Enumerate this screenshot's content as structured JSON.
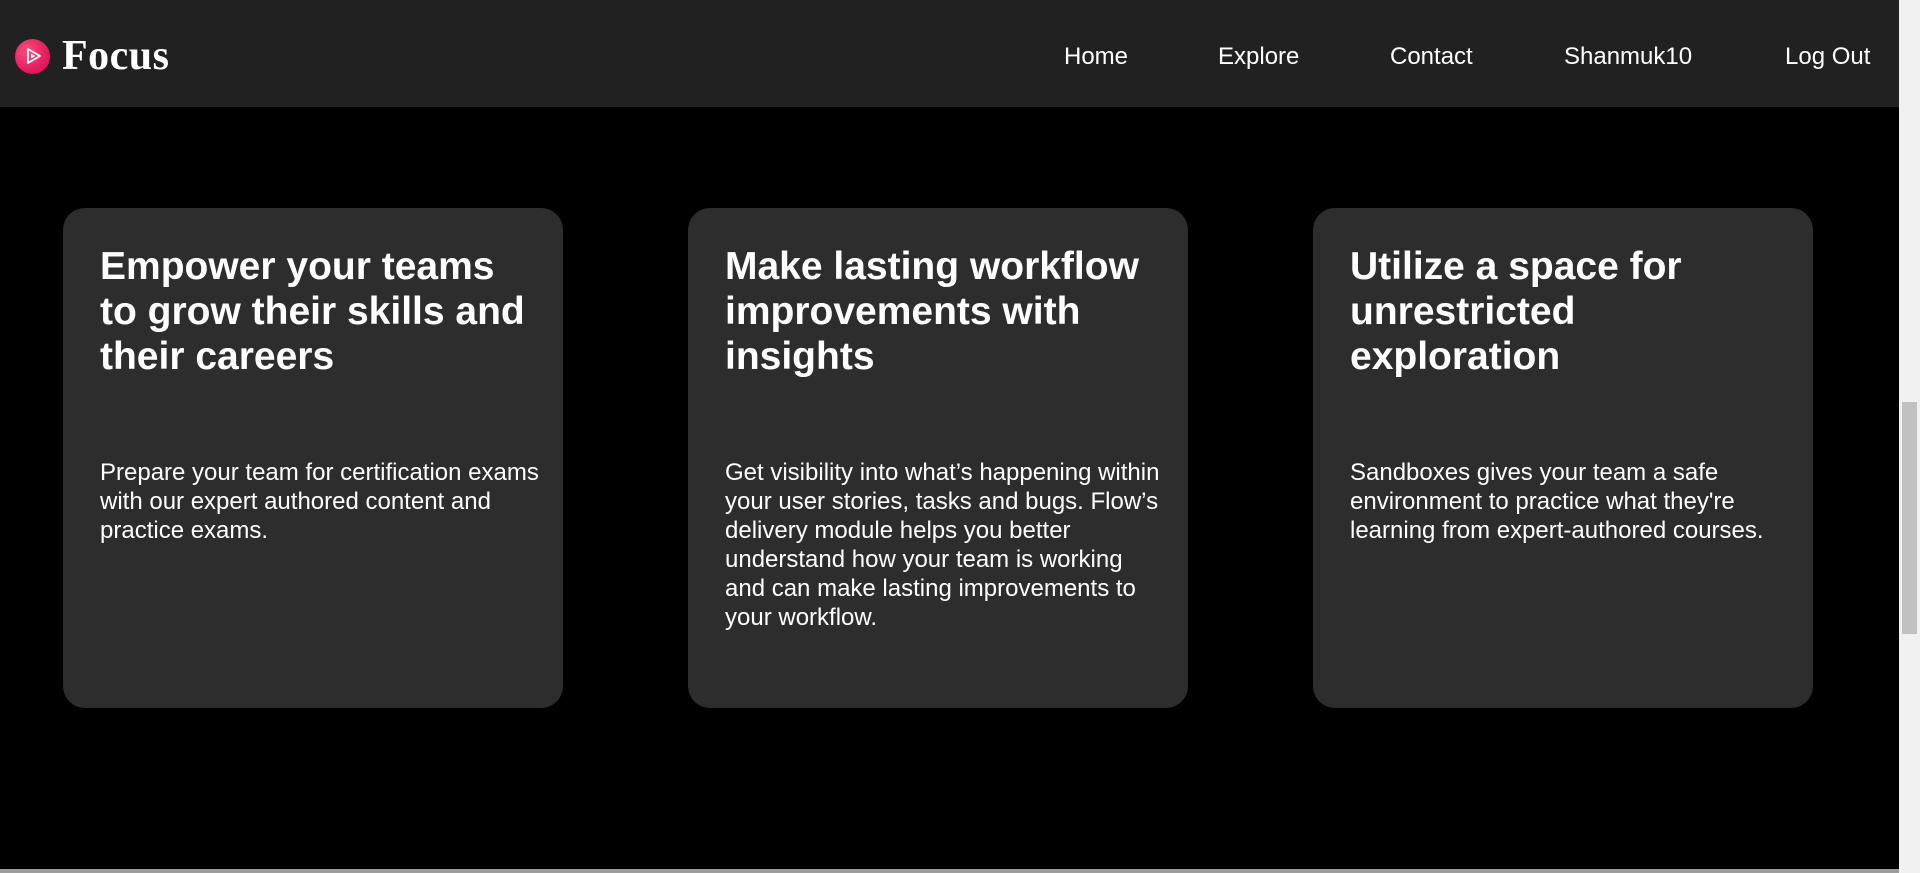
{
  "brand": {
    "logo_icon": "play-circle-icon",
    "name": "Focus",
    "logo_color": "#e91e63"
  },
  "nav": {
    "items": [
      {
        "label": "Home"
      },
      {
        "label": "Explore"
      },
      {
        "label": "Contact"
      },
      {
        "label": "Shanmuk10"
      },
      {
        "label": "Log Out"
      }
    ]
  },
  "cards": [
    {
      "title": "Empower your teams to grow their skills and their careers",
      "text": "Prepare your team for certification exams with our expert authored content and practice exams."
    },
    {
      "title": "Make lasting workflow improvements with insights",
      "text": "Get visibility into what’s happening within your user stories, tasks and bugs. Flow’s delivery module helps you better understand how your team is working and can make lasting improvements to your workflow."
    },
    {
      "title": "Utilize a space for unrestricted exploration",
      "text": "Sandboxes gives your team a safe environment to practice what they're learning from expert-authored courses."
    }
  ],
  "theme": {
    "page_background": "#000000",
    "navbar_background": "#212121",
    "card_background": "#2d2d2d",
    "text_color": "#ffffff"
  }
}
